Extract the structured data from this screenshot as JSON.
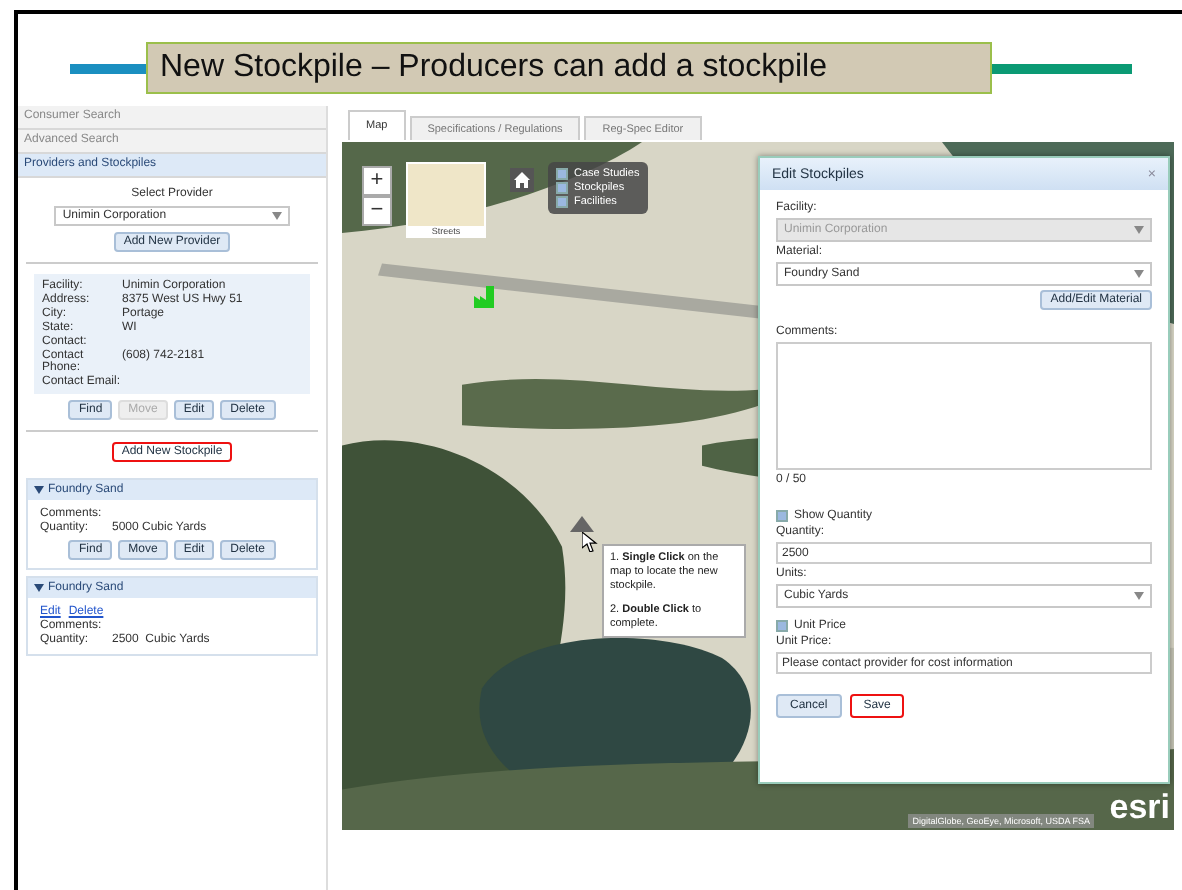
{
  "slide_title": "New Stockpile – Producers can add a stockpile",
  "accordion": [
    {
      "label": "Consumer Search",
      "selected": false
    },
    {
      "label": "Advanced Search",
      "selected": false
    },
    {
      "label": "Providers and Stockpiles",
      "selected": true
    }
  ],
  "providers": {
    "select_label": "Select Provider",
    "provider": "Unimin Corporation",
    "add_provider_button": "Add New Provider",
    "details": [
      {
        "label": "Facility:",
        "value": "Unimin Corporation"
      },
      {
        "label": "Address:",
        "value": "8375 West US Hwy 51"
      },
      {
        "label": "City:",
        "value": "Portage"
      },
      {
        "label": "State:",
        "value": "WI"
      },
      {
        "label": "Contact:"
      },
      {
        "label": "Contact Phone:",
        "value": "(608) 742-2181"
      },
      {
        "label": "Contact Email:"
      }
    ],
    "buttons": [
      {
        "label": "Find",
        "disabled": false
      },
      {
        "label": "Move",
        "disabled": true
      },
      {
        "label": "Edit",
        "disabled": false
      },
      {
        "label": "Delete",
        "disabled": false
      }
    ],
    "add_stockpile_button": {
      "label": "Add New Stockpile",
      "highlighted": true
    }
  },
  "stockpiles": [
    {
      "title": "Foundry Sand",
      "kind": "buttons",
      "actions": [
        "Find",
        "Move",
        "Edit",
        "Delete"
      ],
      "fields": [
        {
          "label": "Comments:"
        },
        {
          "label": "Quantity:",
          "value": "5000 Cubic Yards"
        }
      ]
    },
    {
      "title": "Foundry Sand",
      "kind": "links",
      "actions": [
        "Edit",
        "Delete"
      ],
      "fields": [
        {
          "label": "Comments:"
        },
        {
          "label": "Quantity:",
          "value": "2500  Cubic Yards"
        }
      ]
    }
  ],
  "tabs": [
    {
      "label": "Map",
      "selected": true
    },
    {
      "label": "Specifications / Regulations",
      "selected": false
    },
    {
      "label": "Reg-Spec Editor",
      "selected": false
    }
  ],
  "map": {
    "zoom_in": "+",
    "zoom_out": "−",
    "basemap": "Streets",
    "layers": [
      {
        "label": "Case Studies",
        "checked": true
      },
      {
        "label": "Stockpiles",
        "checked": true
      },
      {
        "label": "Facilities",
        "checked": true
      }
    ],
    "tooltip": [
      "1. **Single Click** on the map to locate the new stockpile.",
      "2. **Double Click** to complete."
    ],
    "attribution": "DigitalGlobe, GeoEye, Microsoft, USDA FSA",
    "logo": "esri"
  },
  "dialog": {
    "title": "Edit Stockpiles",
    "close": "×",
    "items": [
      {
        "kind": "select",
        "label": "Facility:",
        "value": "Unimin Corporation",
        "disabled": true
      },
      {
        "kind": "select",
        "label": "Material:",
        "value": "Foundry Sand",
        "disabled": false
      },
      {
        "kind": "button",
        "label": "Add/Edit Material"
      },
      {
        "kind": "textarea",
        "label": "Comments:"
      },
      {
        "kind": "counter",
        "label": "0 / 50"
      },
      {
        "kind": "checkbox",
        "label": "Show Quantity",
        "checked": true
      },
      {
        "kind": "text",
        "label": "Quantity:",
        "value": "2500"
      },
      {
        "kind": "select",
        "label": "Units:",
        "value": "Cubic Yards",
        "disabled": false
      },
      {
        "kind": "checkbox",
        "label": "Unit Price",
        "checked": true
      },
      {
        "kind": "text",
        "label": "Unit Price:",
        "value": "Please contact provider for cost information"
      }
    ],
    "buttons": [
      {
        "label": "Cancel",
        "highlighted": false
      },
      {
        "label": "Save",
        "highlighted": true
      }
    ]
  }
}
